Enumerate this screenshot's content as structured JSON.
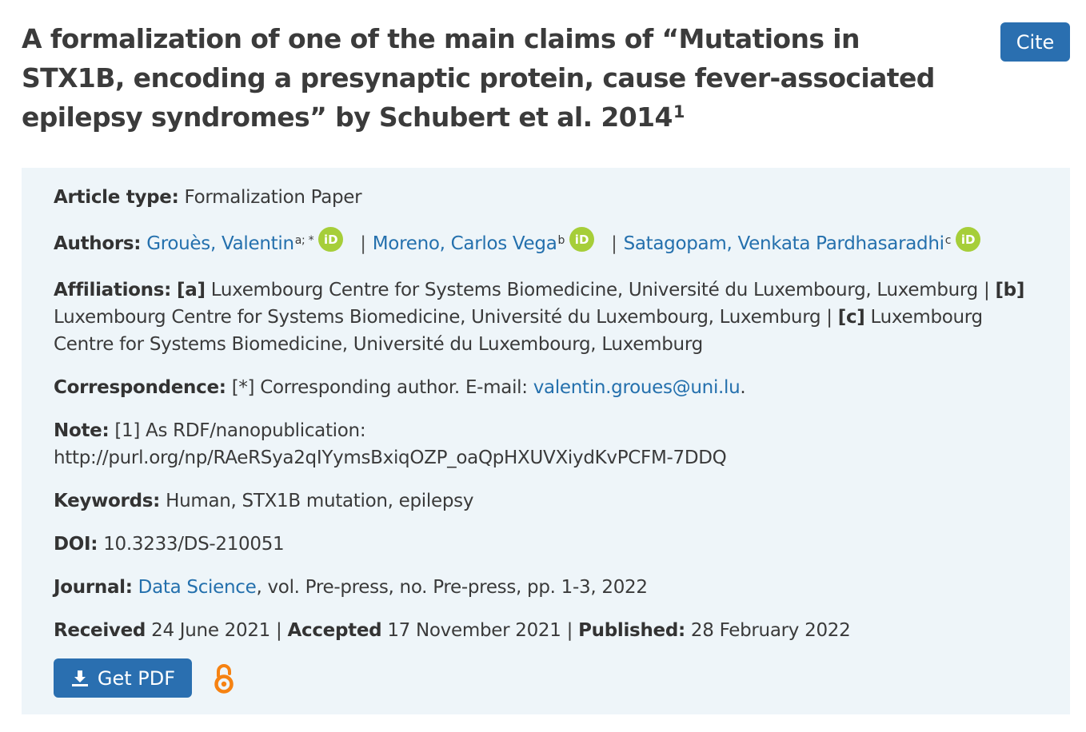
{
  "article": {
    "title": "A formalization of one of the main claims of “Mutations in STX1B, encoding a presynaptic protein, cause fever-associated epilepsy syndromes” by Schubert et al. 2014",
    "title_footnote": "1"
  },
  "cite_button": "Cite",
  "details": {
    "article_type_label": "Article type:",
    "article_type": "Formalization Paper",
    "authors_label": "Authors:",
    "authors": [
      {
        "name": "Grouès, Valentin",
        "affiliation_marker": "a; *"
      },
      {
        "name": "Moreno, Carlos Vega",
        "affiliation_marker": "b"
      },
      {
        "name": "Satagopam, Venkata Pardhasaradhi",
        "affiliation_marker": "c"
      }
    ],
    "author_separator": "|",
    "orcid_icon_text": "iD",
    "affiliations_label": "Affiliations:",
    "affiliations": [
      {
        "marker": "[a]",
        "text": "Luxembourg Centre for Systems Biomedicine, Université du Luxembourg, Luxemburg"
      },
      {
        "marker": "[b]",
        "text": "Luxembourg Centre for Systems Biomedicine, Université du Luxembourg, Luxemburg"
      },
      {
        "marker": "[c]",
        "text": "Luxembourg Centre for Systems Biomedicine, Université du Luxembourg, Luxemburg"
      }
    ],
    "correspondence_label": "Correspondence:",
    "correspondence_text": "[*] Corresponding author. E-mail:",
    "correspondence_email": "valentin.groues@uni.lu",
    "correspondence_end": ".",
    "note_label": "Note:",
    "note_text": "[1] As RDF/nanopublication:",
    "note_url": "http://purl.org/np/RAeRSya2qIYymsBxiqOZP_oaQpHXUVXiydKvPCFM-7DDQ",
    "keywords_label": "Keywords:",
    "keywords": "Human, STX1B mutation, epilepsy",
    "doi_label": "DOI:",
    "doi": "10.3233/DS-210051",
    "journal_label": "Journal:",
    "journal_name": "Data Science",
    "journal_rest": ", vol. Pre-press, no. Pre-press, pp. 1-3, 2022",
    "received_label": "Received",
    "received": "24 June 2021",
    "accepted_label": "Accepted",
    "accepted": "17 November 2021",
    "published_label": "Published:",
    "published": "28 February 2022"
  },
  "get_pdf_button": "Get PDF",
  "icons": {
    "download": "download-icon",
    "open_access": "open-access-icon",
    "orcid": "orcid-icon"
  },
  "colors": {
    "primary_button": "#2a6fb0",
    "link": "#2470ad",
    "panel_bg": "#eef5f9",
    "orcid": "#a6ce39",
    "open_access": "#f68212"
  }
}
